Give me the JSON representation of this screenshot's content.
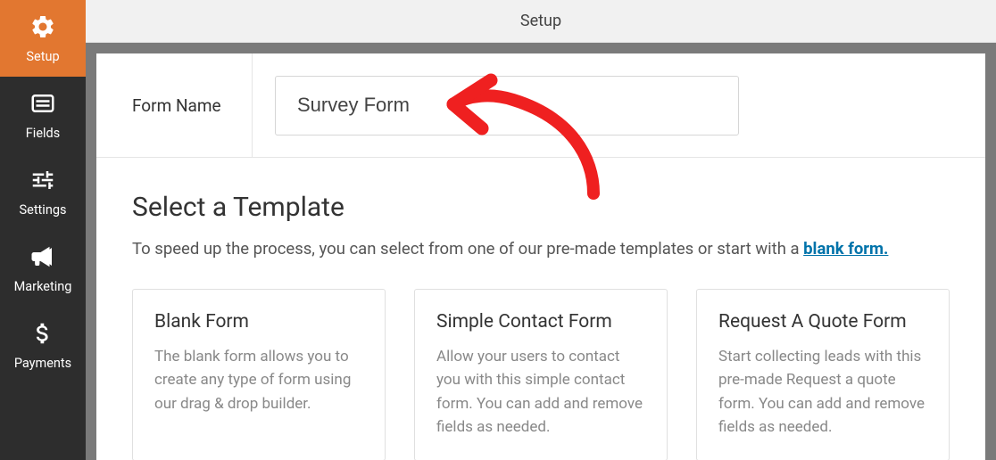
{
  "sidebar": {
    "items": [
      {
        "label": "Setup"
      },
      {
        "label": "Fields"
      },
      {
        "label": "Settings"
      },
      {
        "label": "Marketing"
      },
      {
        "label": "Payments"
      }
    ]
  },
  "topbar": {
    "title": "Setup"
  },
  "form": {
    "name_label": "Form Name",
    "name_value": "Survey Form"
  },
  "templates": {
    "heading": "Select a Template",
    "subtitle_prefix": "To speed up the process, you can select from one of our pre-made templates or start with a ",
    "subtitle_link": "blank form.",
    "cards": [
      {
        "title": "Blank Form",
        "desc": "The blank form allows you to create any type of form using our drag & drop builder."
      },
      {
        "title": "Simple Contact Form",
        "desc": "Allow your users to contact you with this simple contact form. You can add and remove fields as needed."
      },
      {
        "title": "Request A Quote Form",
        "desc": "Start collecting leads with this pre-made Request a quote form. You can add and remove fields as needed."
      }
    ]
  }
}
